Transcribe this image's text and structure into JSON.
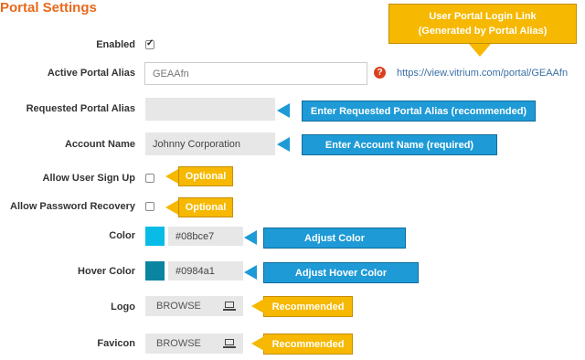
{
  "page": {
    "title": "Portal Settings"
  },
  "fields": {
    "enabled": {
      "label": "Enabled",
      "checked": true
    },
    "active_alias": {
      "label": "Active Portal Alias",
      "value": "GEAAfn",
      "link": "https://view.vitrium.com/portal/GEAAfn"
    },
    "requested_alias": {
      "label": "Requested Portal Alias",
      "value": ""
    },
    "account_name": {
      "label": "Account Name",
      "value": "Johnny Corporation"
    },
    "allow_signup": {
      "label": "Allow User Sign Up",
      "checked": false
    },
    "allow_recovery": {
      "label": "Allow Password Recovery",
      "checked": false
    },
    "color": {
      "label": "Color",
      "value": "#08bce7"
    },
    "hover_color": {
      "label": "Hover Color",
      "value": "#0984a1"
    },
    "logo": {
      "label": "Logo",
      "button": "BROWSE"
    },
    "favicon": {
      "label": "Favicon",
      "button": "BROWSE"
    }
  },
  "callouts": {
    "login_link_line1": "User Portal Login Link",
    "login_link_line2": "(Generated by Portal Alias)",
    "requested_alias": "Enter Requested Portal Alias (recommended)",
    "account_name": "Enter Account Name (required)",
    "signup": "Optional",
    "recovery": "Optional",
    "color": "Adjust Color",
    "hover_color": "Adjust Hover Color",
    "logo": "Recommended",
    "favicon": "Recommended"
  },
  "icons": {
    "help": "help-icon",
    "laptop": "laptop-icon",
    "check": "checkmark-icon"
  },
  "colors": {
    "title": "#e8691c",
    "callout_blue": "#1e9ad6",
    "callout_yellow": "#f6b800",
    "help": "#d9401f",
    "link": "#3a6fa5"
  }
}
